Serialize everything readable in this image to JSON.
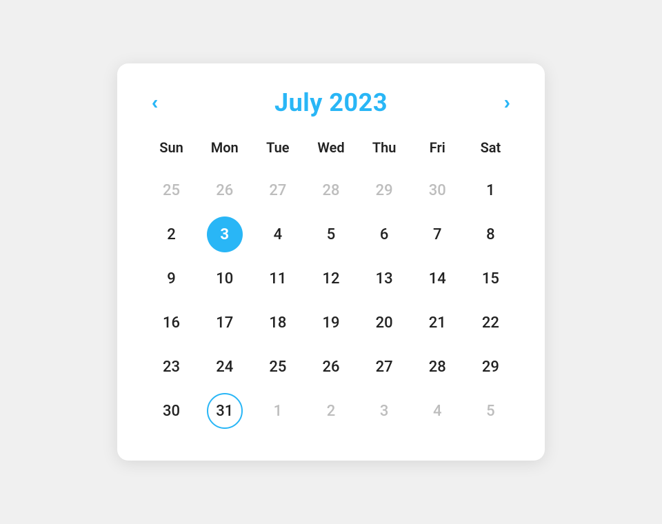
{
  "header": {
    "title": "July 2023",
    "prev_label": "‹",
    "next_label": "›"
  },
  "weekdays": [
    "Sun",
    "Mon",
    "Tue",
    "Wed",
    "Thu",
    "Fri",
    "Sat"
  ],
  "weeks": [
    [
      {
        "day": "25",
        "type": "other-month"
      },
      {
        "day": "26",
        "type": "other-month"
      },
      {
        "day": "27",
        "type": "other-month"
      },
      {
        "day": "28",
        "type": "other-month"
      },
      {
        "day": "29",
        "type": "other-month"
      },
      {
        "day": "30",
        "type": "other-month"
      },
      {
        "day": "1",
        "type": "current"
      }
    ],
    [
      {
        "day": "2",
        "type": "current"
      },
      {
        "day": "3",
        "type": "selected"
      },
      {
        "day": "4",
        "type": "current"
      },
      {
        "day": "5",
        "type": "current"
      },
      {
        "day": "6",
        "type": "current"
      },
      {
        "day": "7",
        "type": "current"
      },
      {
        "day": "8",
        "type": "current"
      }
    ],
    [
      {
        "day": "9",
        "type": "current"
      },
      {
        "day": "10",
        "type": "current"
      },
      {
        "day": "11",
        "type": "current"
      },
      {
        "day": "12",
        "type": "current"
      },
      {
        "day": "13",
        "type": "current"
      },
      {
        "day": "14",
        "type": "current"
      },
      {
        "day": "15",
        "type": "current"
      }
    ],
    [
      {
        "day": "16",
        "type": "current"
      },
      {
        "day": "17",
        "type": "current"
      },
      {
        "day": "18",
        "type": "current"
      },
      {
        "day": "19",
        "type": "current"
      },
      {
        "day": "20",
        "type": "current"
      },
      {
        "day": "21",
        "type": "current"
      },
      {
        "day": "22",
        "type": "current"
      }
    ],
    [
      {
        "day": "23",
        "type": "current"
      },
      {
        "day": "24",
        "type": "current"
      },
      {
        "day": "25",
        "type": "current"
      },
      {
        "day": "26",
        "type": "current"
      },
      {
        "day": "27",
        "type": "current"
      },
      {
        "day": "28",
        "type": "current"
      },
      {
        "day": "29",
        "type": "current"
      }
    ],
    [
      {
        "day": "30",
        "type": "current"
      },
      {
        "day": "31",
        "type": "today-outline"
      },
      {
        "day": "1",
        "type": "other-month"
      },
      {
        "day": "2",
        "type": "other-month"
      },
      {
        "day": "3",
        "type": "other-month"
      },
      {
        "day": "4",
        "type": "other-month"
      },
      {
        "day": "5",
        "type": "other-month"
      }
    ]
  ],
  "colors": {
    "accent": "#29b6f6",
    "other_month": "#bdbdbd",
    "text": "#222222"
  }
}
